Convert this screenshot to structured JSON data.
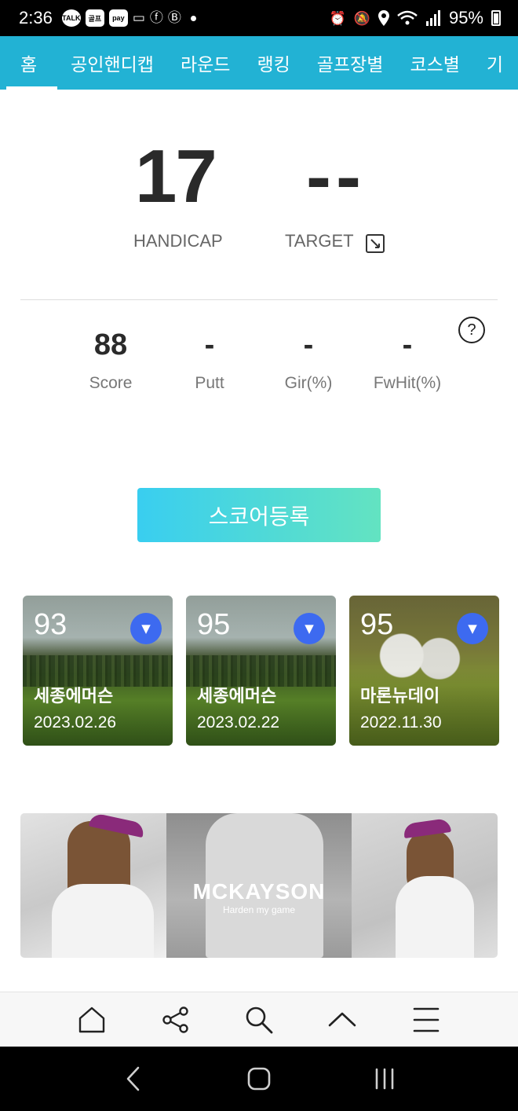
{
  "status_bar": {
    "time": "2:36",
    "left_icons": [
      "TALK",
      "골프",
      "pay"
    ],
    "battery_text": "95%",
    "icons": [
      "kakaotalk-icon",
      "app-icon",
      "pay-icon",
      "card-icon",
      "facebook-icon",
      "b-icon",
      "alarm-icon",
      "mute-icon",
      "location-icon",
      "wifi-icon",
      "signal-icon",
      "battery-icon"
    ]
  },
  "tabs": [
    {
      "label": "홈",
      "active": true
    },
    {
      "label": "공인핸디캡"
    },
    {
      "label": "라운드"
    },
    {
      "label": "랭킹"
    },
    {
      "label": "골프장별"
    },
    {
      "label": "코스별"
    },
    {
      "label": "기"
    }
  ],
  "handicap": {
    "value": "17",
    "label": "HANDICAP",
    "target_value": "--",
    "target_label": "TARGET"
  },
  "stats": [
    {
      "value": "88",
      "label": "Score"
    },
    {
      "value": "-",
      "label": "Putt"
    },
    {
      "value": "-",
      "label": "Gir(%)"
    },
    {
      "value": "-",
      "label": "FwHit(%)"
    }
  ],
  "help_symbol": "?",
  "register_button": "스코어등록",
  "rounds": [
    {
      "score": "93",
      "course": "세종에머슨",
      "date": "2023.02.26"
    },
    {
      "score": "95",
      "course": "세종에머슨",
      "date": "2023.02.22"
    },
    {
      "score": "95",
      "course": "마론뉴데이",
      "date": "2022.11.30"
    }
  ],
  "card_toggle_symbol": "▼",
  "banner": {
    "brand": "MCKAYSON",
    "tagline": "Harden my game"
  },
  "colors": {
    "tab_bar": "#22b2d4",
    "button_start": "#39cef0",
    "button_end": "#63e3c1",
    "toggle": "#3d6af0"
  }
}
